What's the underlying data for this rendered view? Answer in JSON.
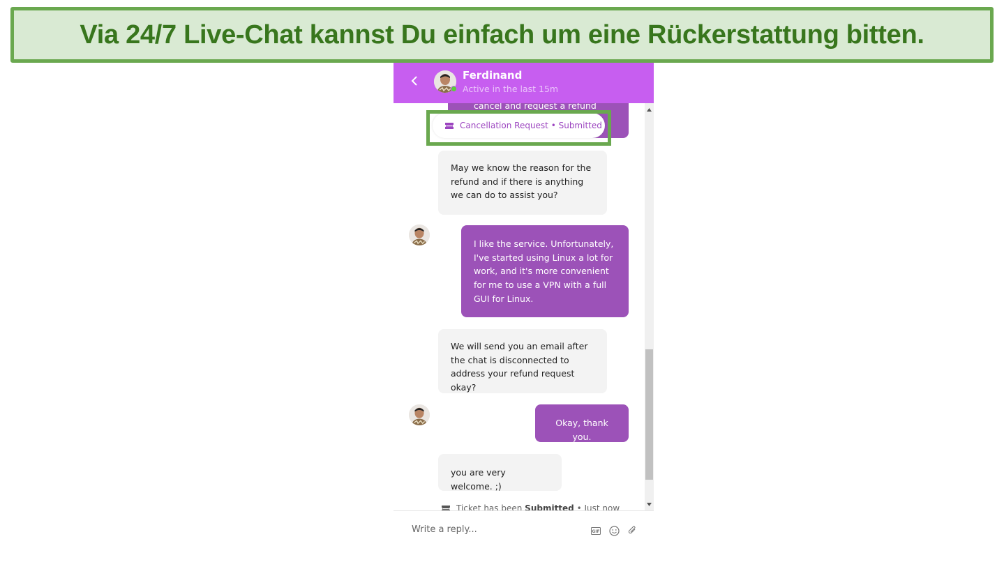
{
  "banner": {
    "text": "Via 24/7 Live-Chat kannst Du einfach um eine Rückerstattung bitten."
  },
  "chat": {
    "header": {
      "agent_name": "Ferdinand",
      "agent_status": "Active in the last 15m",
      "back_icon": "chevron-left-icon",
      "online": true
    },
    "messages": [
      {
        "from": "user",
        "text": "cancel and request a refund"
      },
      {
        "from": "system",
        "icon": "ticket-icon",
        "text": "Cancellation Request • Submitted"
      },
      {
        "from": "agent",
        "text": "May we know the reason for the refund and if there is anything we can do to assist you?"
      },
      {
        "from": "user",
        "text": "I like the service. Unfortunately, I've started using Linux a lot for work, and it's more convenient for me to use a VPN with a full GUI for Linux."
      },
      {
        "from": "agent",
        "text": "We will send you an email after the chat is disconnected to address your refund request okay?"
      },
      {
        "from": "user",
        "text": "Okay, thank you."
      },
      {
        "from": "agent",
        "text": "you are very welcome. ;)"
      }
    ],
    "ticket_status": {
      "prefix": "Ticket has been",
      "status": "Submitted",
      "suffix": "• Just now"
    },
    "composer": {
      "placeholder": "Write a reply...",
      "icons": [
        "gif-icon",
        "emoji-icon",
        "attachment-icon"
      ]
    }
  },
  "colors": {
    "header_bg": "#c75ef0",
    "user_bubble": "#9c52b8",
    "agent_bubble": "#f3f3f3",
    "highlight_green": "#6aa84f",
    "banner_bg": "#d9ead3",
    "banner_text": "#38761d"
  }
}
